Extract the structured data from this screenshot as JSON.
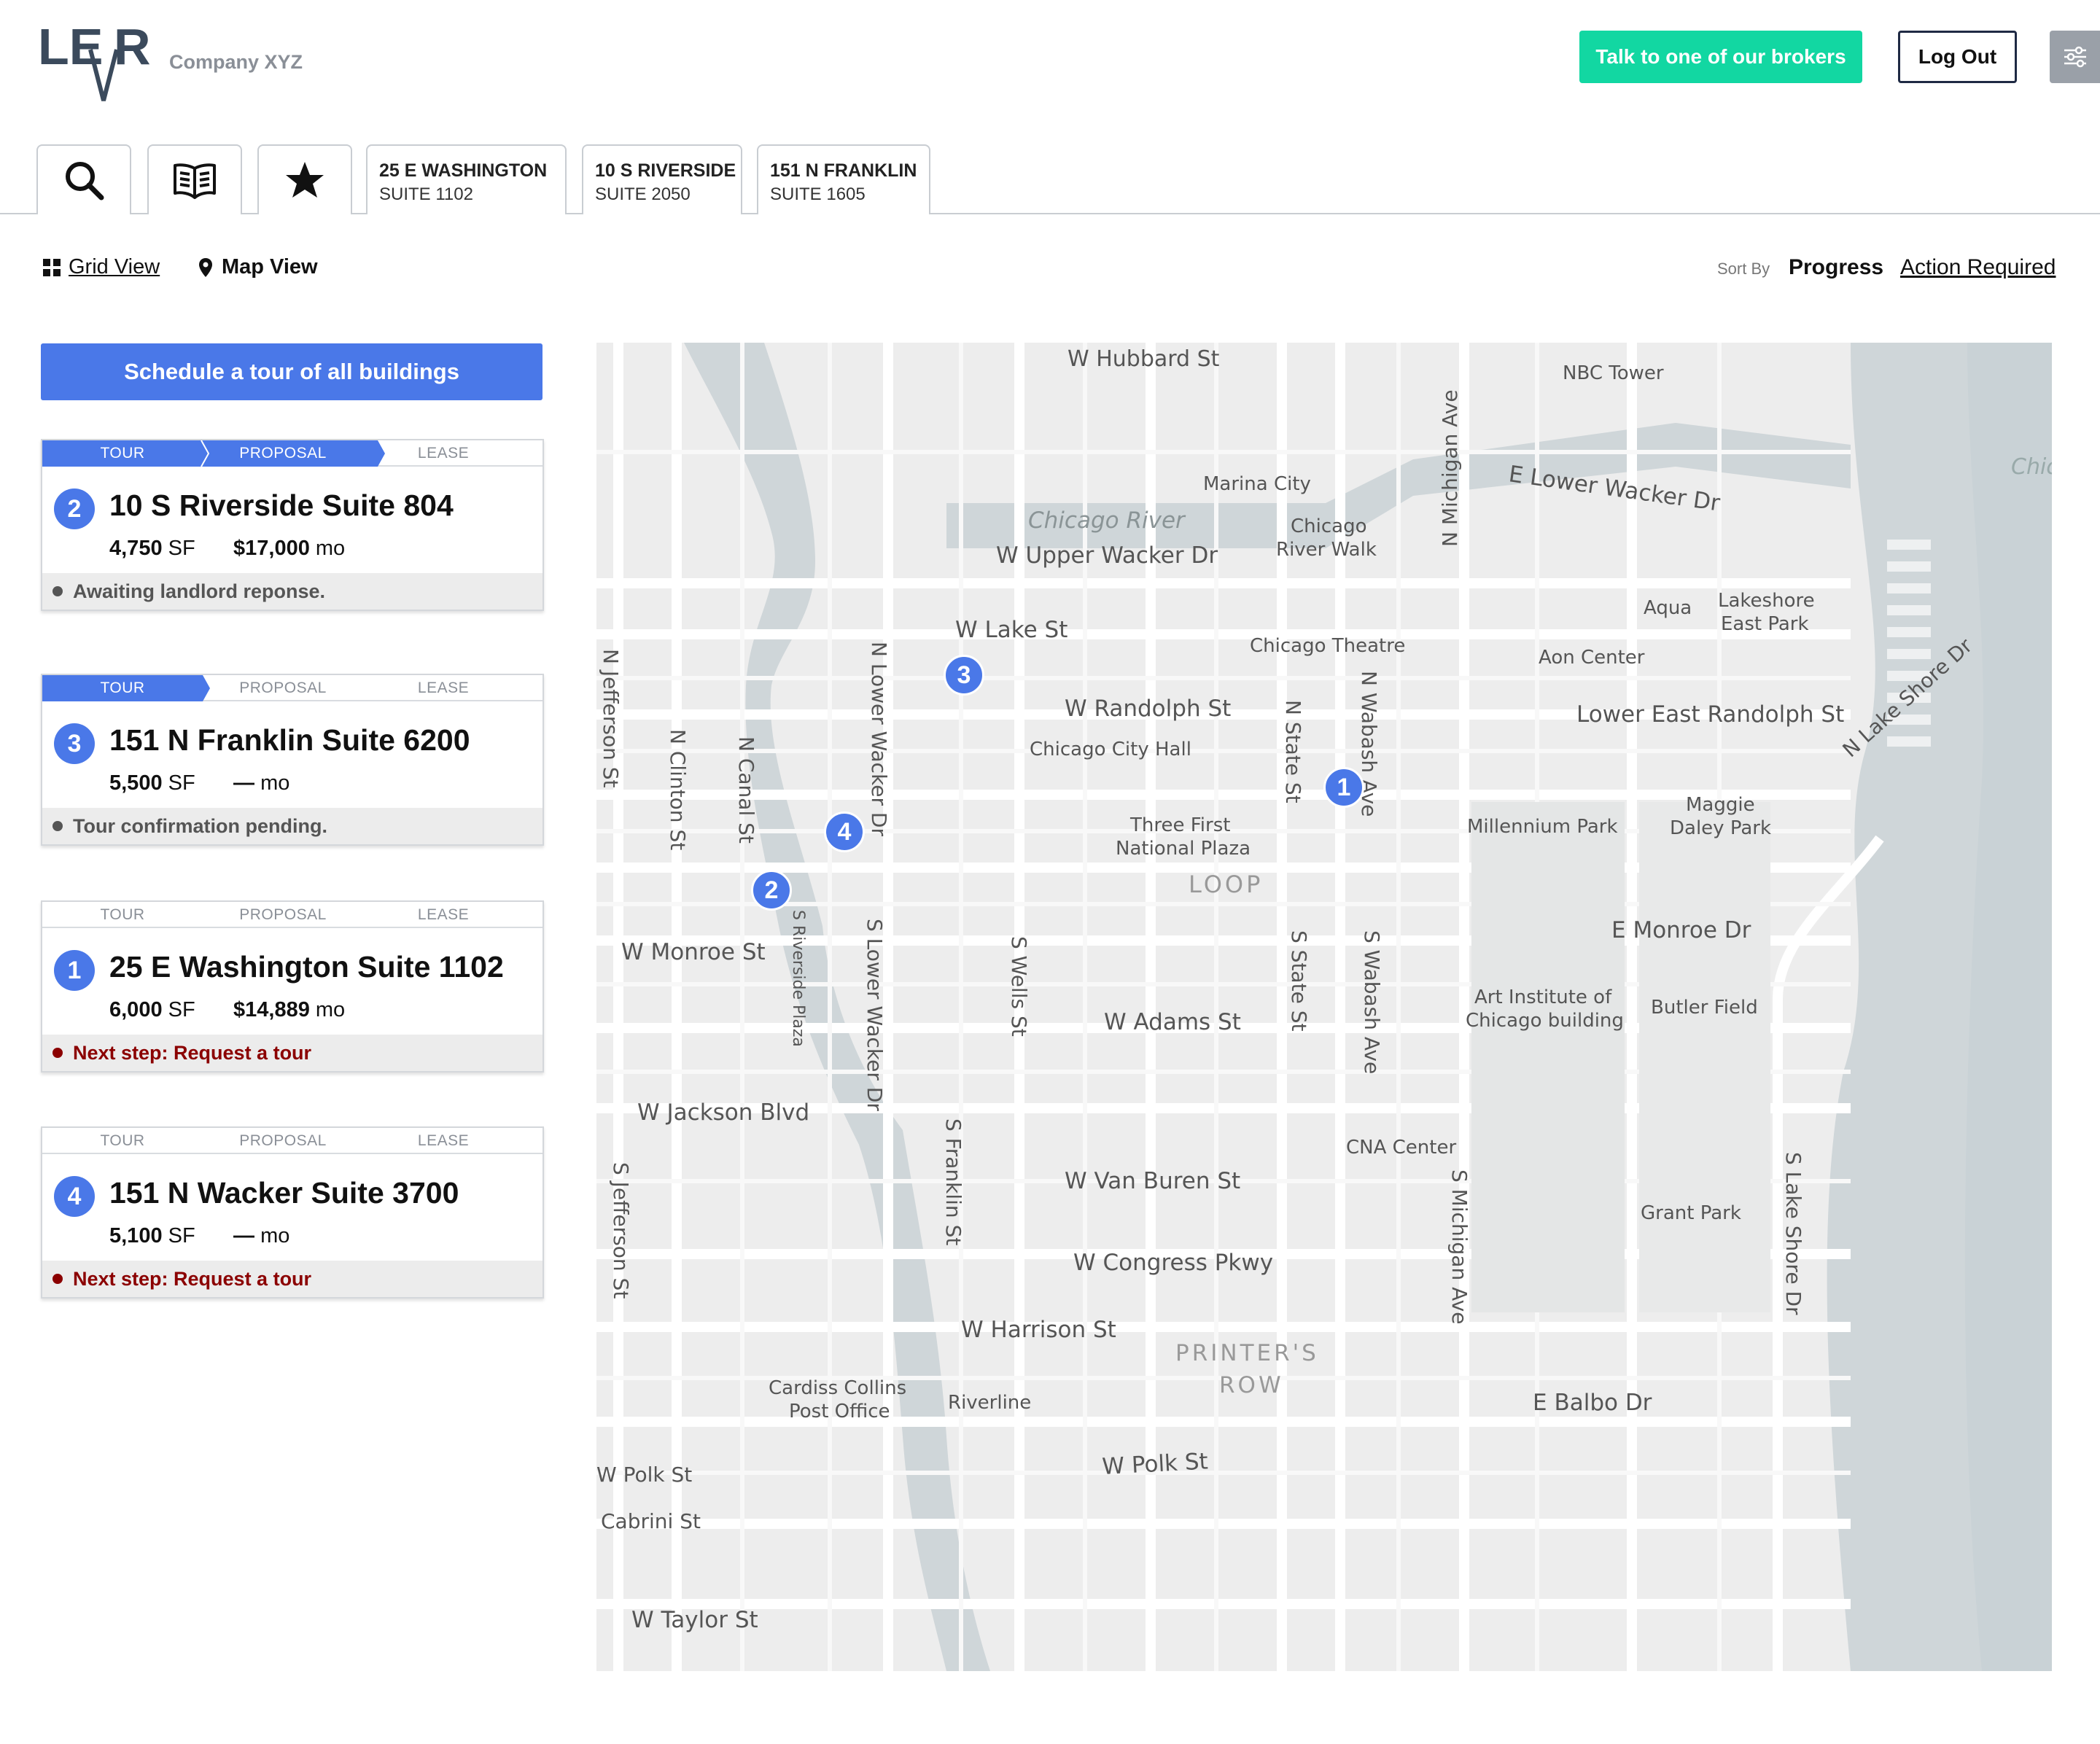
{
  "header": {
    "company": "Company XYZ",
    "broker_button": "Talk to one of our brokers",
    "logout_button": "Log Out"
  },
  "tabs": {
    "buildings": [
      {
        "address": "25 E WASHINGTON",
        "suite": "SUITE 1102"
      },
      {
        "address": "10 S RIVERSIDE",
        "suite": "SUITE 2050"
      },
      {
        "address": "151 N FRANKLIN",
        "suite": "SUITE 1605"
      }
    ]
  },
  "view": {
    "grid": "Grid View",
    "map": "Map View",
    "sort_label": "Sort By",
    "sort_progress": "Progress",
    "sort_action": "Action Required"
  },
  "schedule_button": "Schedule a tour of all buildings",
  "stages": [
    "TOUR",
    "PROPOSAL",
    "LEASE"
  ],
  "cards": [
    {
      "number": "2",
      "title": "10 S Riverside Suite 804",
      "sf": "4,750",
      "sf_unit": "SF",
      "price": "$17,000",
      "price_unit": "mo",
      "status": "Awaiting landlord reponse.",
      "progress_stage": 2,
      "status_type": "neutral"
    },
    {
      "number": "3",
      "title": "151 N Franklin Suite 6200",
      "sf": "5,500",
      "sf_unit": "SF",
      "price": "—",
      "price_unit": "mo",
      "status": "Tour confirmation pending.",
      "progress_stage": 1,
      "status_type": "neutral"
    },
    {
      "number": "1",
      "title": "25 E Washington Suite 1102",
      "sf": "6,000",
      "sf_unit": "SF",
      "price": "$14,889",
      "price_unit": "mo",
      "status": "Next step: Request a tour",
      "progress_stage": 0,
      "status_type": "action"
    },
    {
      "number": "4",
      "title": "151 N Wacker Suite 3700",
      "sf": "5,100",
      "sf_unit": "SF",
      "price": "—",
      "price_unit": "mo",
      "status": "Next step: Request a tour",
      "progress_stage": 0,
      "status_type": "action"
    }
  ],
  "map": {
    "markers": [
      "1",
      "2",
      "3",
      "4"
    ],
    "labels": {
      "hubbard": "W Hubbard St",
      "nbc": "NBC Tower",
      "chic": "Chic",
      "lower_wacker": "E Lower Wacker Dr",
      "marina": "Marina City",
      "chicago_river": "Chicago River",
      "river_walk_1": "Chicago",
      "river_walk_2": "River Walk",
      "upper_wacker": "W Upper Wacker Dr",
      "michigan_n": "N Michigan Ave",
      "aqua": "Aqua",
      "lakeshore_1": "Lakeshore",
      "lakeshore_2": "East Park",
      "aon": "Aon Center",
      "lake_st": "W Lake St",
      "chicago_theatre": "Chicago Theatre",
      "randolph": "W Randolph St",
      "lower_randolph": "Lower East Randolph St",
      "city_hall": "Chicago City Hall",
      "jefferson_n": "N Jefferson St",
      "clinton": "N Clinton St",
      "canal": "N Canal St",
      "lower_wacker_n": "N Lower Wacker Dr",
      "state_n": "N State St",
      "wabash_n": "N Wabash Ave",
      "millennium": "Millennium Park",
      "maggie_1": "Maggie",
      "maggie_2": "Daley Park",
      "lake_shore_n": "N Lake Shore Dr",
      "three_first_1": "Three First",
      "three_first_2": "National Plaza",
      "loop": "LOOP",
      "monroe_w": "W Monroe St",
      "riverside_plaza": "S Riverside Plaza",
      "lower_wacker_s": "S Lower Wacker Dr",
      "wells": "S Wells St",
      "state_s": "S State St",
      "wabash_s": "S Wabash Ave",
      "monroe_e": "E Monroe Dr",
      "art_1": "Art Institute of",
      "art_2": "Chicago building",
      "butler": "Butler Field",
      "adams": "W Adams St",
      "jackson": "W Jackson Blvd",
      "cna": "CNA Center",
      "franklin_s": "S Franklin St",
      "van_buren": "W Van Buren St",
      "michigan_s": "S Michigan Ave",
      "grant": "Grant Park",
      "lake_shore_s": "S Lake Shore Dr",
      "jefferson_s": "S Jefferson St",
      "congress": "W Congress Pkwy",
      "harrison": "W Harrison St",
      "printers_1": "PRINTER'S",
      "printers_2": "ROW",
      "cardiss_1": "Cardiss Collins",
      "cardiss_2": "Post Office",
      "riverline": "Riverline",
      "balbo": "E Balbo Dr",
      "polk_w": "W Polk St",
      "polk": "W Polk St",
      "cabrini": "Cabrini St",
      "taylor": "W Taylor St"
    }
  },
  "colors": {
    "accent": "#4a78e8",
    "broker": "#12d7a2",
    "action_status": "#8b0000",
    "neutral_status": "#555555"
  }
}
